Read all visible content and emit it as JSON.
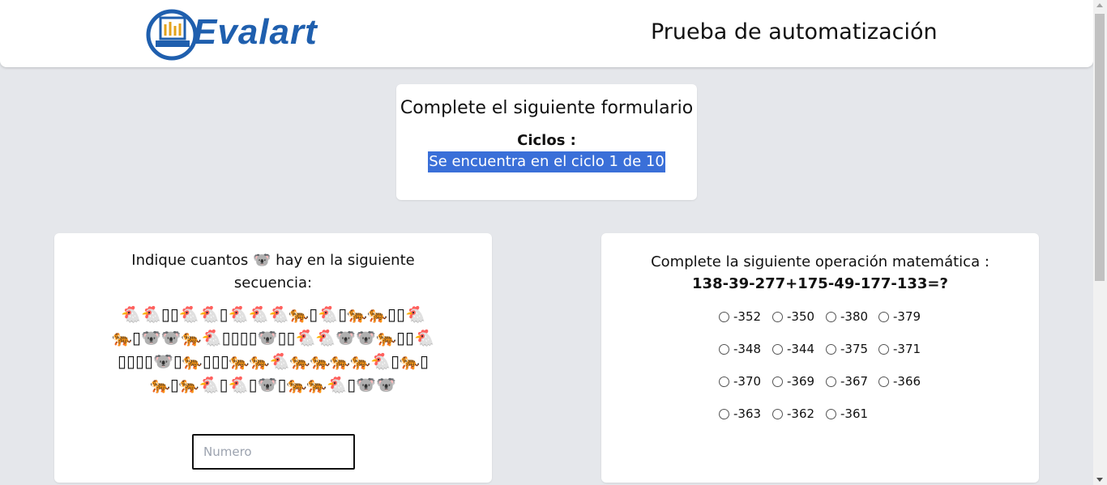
{
  "header": {
    "logo_text": "Evalart",
    "title": "Prueba de automatización"
  },
  "cycles": {
    "form_title": "Complete el siguiente formulario",
    "label": "Ciclos :",
    "status": "Se encuentra en el ciclo 1 de 10"
  },
  "count_question": {
    "text": "Indique cuantos 🐨 hay en la siguiente secuencia:",
    "sequence": "🐔🐔▯▯🐔🐔▯🐔🐔🐔🐅▯🐔▯🐅🐅▯▯🐔🐅▯🐨🐨🐅🐔▯▯▯▯🐨▯▯🐔🐔🐨🐨🐅▯▯🐔▯▯▯▯🐨▯🐅▯▯▯🐅🐅🐔🐅🐅🐅🐅🐔▯🐅▯🐅▯🐅🐔▯🐔▯🐨▯🐅🐅🐔▯🐨🐨",
    "input_placeholder": "Numero",
    "input_value": ""
  },
  "math_question": {
    "text": "Complete la siguiente operación matemática :",
    "operation": "138-39-277+175-49-177-133=?",
    "options": [
      "-352",
      "-350",
      "-380",
      "-379",
      "-348",
      "-344",
      "-375",
      "-371",
      "-370",
      "-369",
      "-367",
      "-366",
      "-363",
      "-362",
      "-361"
    ]
  },
  "colors": {
    "brand": "#1f5fae",
    "selection": "#3a6fd8",
    "background": "#e5e7eb"
  }
}
